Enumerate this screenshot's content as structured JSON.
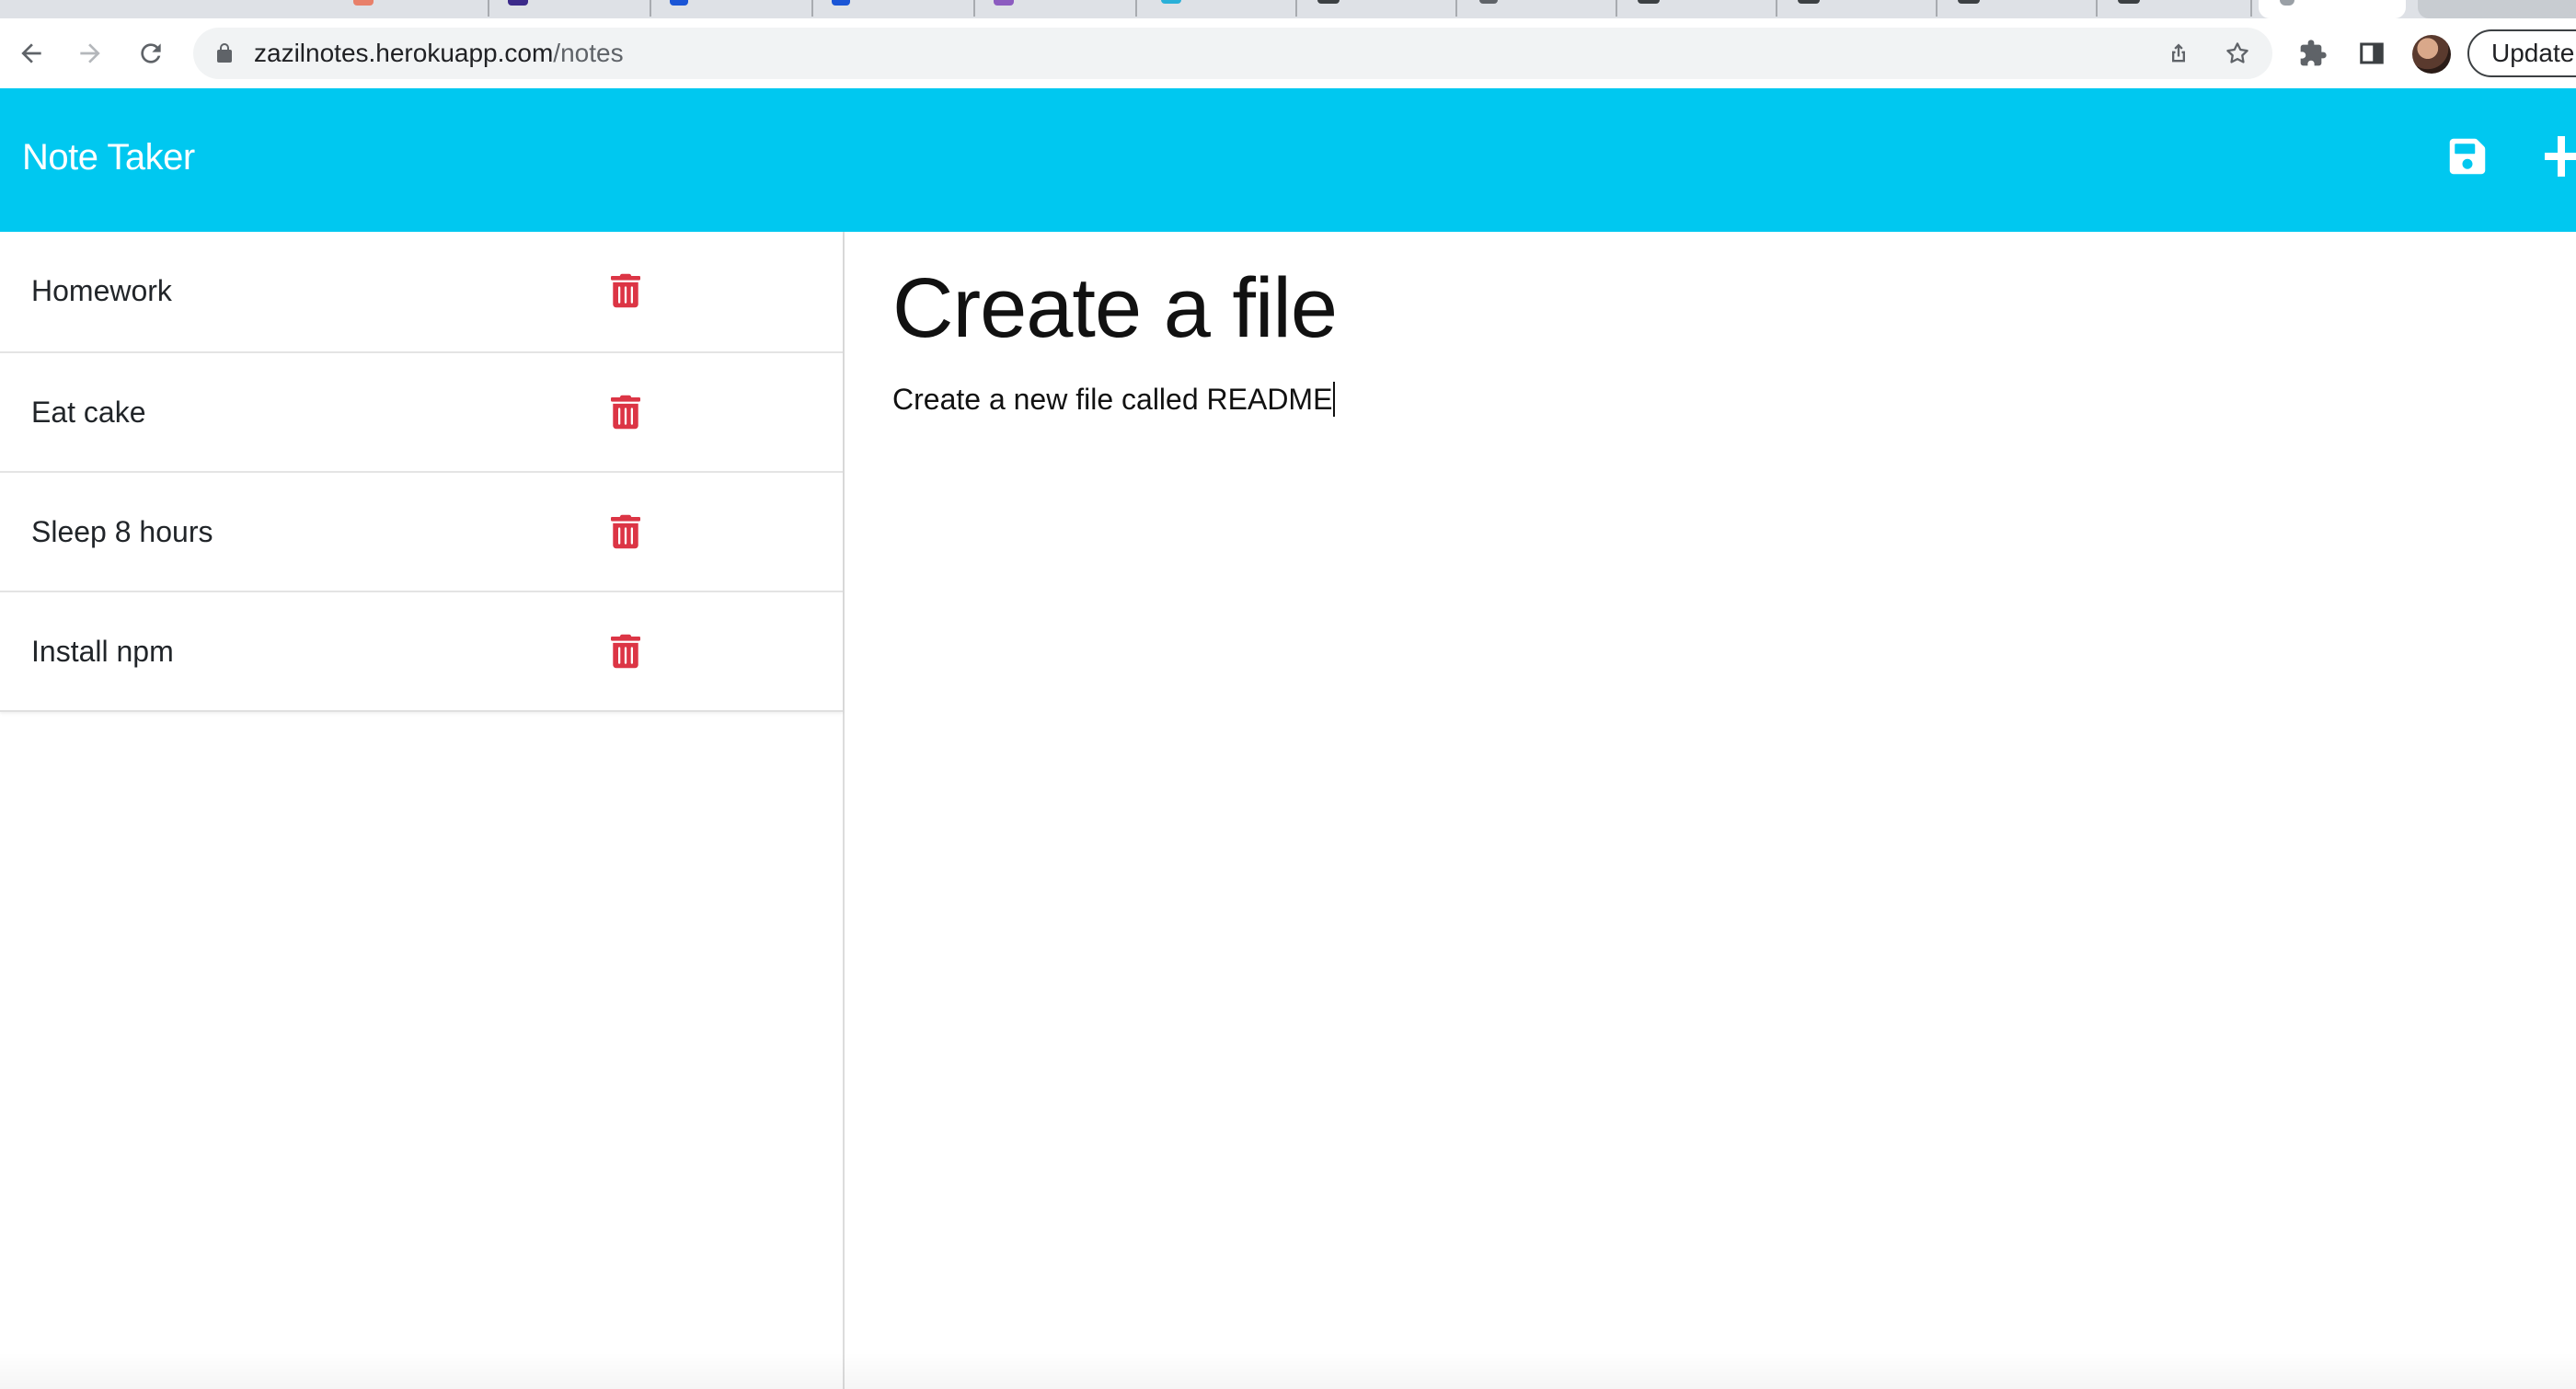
{
  "browser": {
    "url_host": "zazilnotes.herokuapp.com",
    "url_path": "/notes",
    "update_label": "Update",
    "icons": {
      "back": "arrow-left-icon",
      "forward": "arrow-right-icon",
      "reload": "reload-icon",
      "lock": "lock-icon",
      "share": "share-icon",
      "bookmark": "star-icon",
      "extensions": "puzzle-icon",
      "side_panel": "side-panel-icon",
      "profile": "avatar"
    }
  },
  "navbar": {
    "brand": "Note Taker",
    "background": "#00c8f0",
    "icons": {
      "save": "save-icon",
      "new_note": "plus-icon"
    }
  },
  "notes": [
    {
      "title": "Homework",
      "delete_icon": "trash-icon"
    },
    {
      "title": "Eat cake",
      "delete_icon": "trash-icon"
    },
    {
      "title": "Sleep 8 hours",
      "delete_icon": "trash-icon"
    },
    {
      "title": "Install npm",
      "delete_icon": "trash-icon"
    }
  ],
  "editor": {
    "title_value": "Create a file",
    "body_value": "Create a new file called README"
  },
  "colors": {
    "delete": "#dc3545",
    "text": "#212529"
  }
}
